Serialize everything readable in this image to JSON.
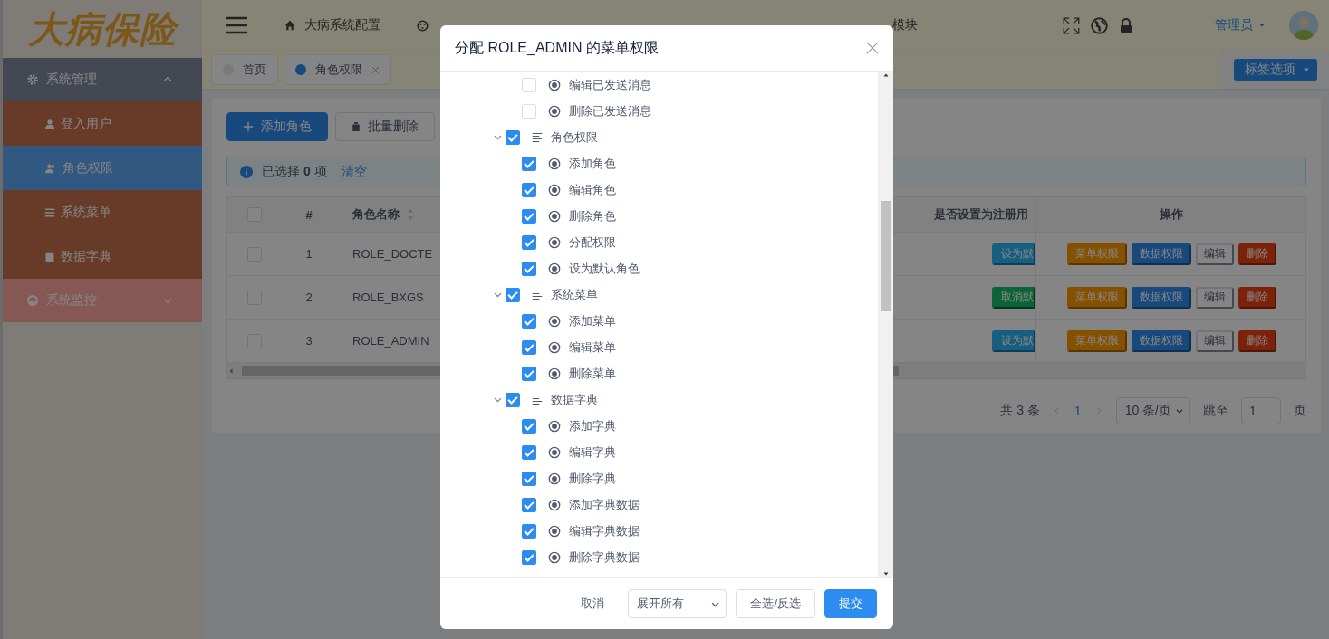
{
  "sidebar": {
    "logo": "大病保险",
    "menu": [
      {
        "label": "系统管理",
        "expanded": true,
        "children": [
          {
            "label": "登入用户",
            "selected": false
          },
          {
            "label": "角色权限",
            "selected": true
          },
          {
            "label": "系统菜单",
            "selected": false
          },
          {
            "label": "数据字典",
            "selected": false
          }
        ]
      },
      {
        "label": "系统监控",
        "expanded": false
      }
    ]
  },
  "header": {
    "nav": [
      {
        "kind": "link",
        "label": "大病系统配置"
      },
      {
        "kind": "icon"
      },
      {
        "kind": "text",
        "label": "模块"
      }
    ],
    "user": "管理员"
  },
  "tabs": [
    {
      "label": "首页",
      "selected": false,
      "closable": false
    },
    {
      "label": "角色权限",
      "selected": true,
      "closable": true
    }
  ],
  "tab_options": "标签选项",
  "toolbar": [
    {
      "label": "添加角色",
      "kind": "primary"
    },
    {
      "label": "批量删除",
      "kind": "default"
    }
  ],
  "alert": {
    "text": "已选择 **0** 项",
    "link": "清空"
  },
  "table": {
    "header_checked": false,
    "columns": [
      {
        "label": "#"
      },
      {
        "label": "角色名称",
        "sortable": true
      },
      {
        "label": "是否设置为注册用"
      },
      {
        "label": "操作"
      }
    ],
    "rows": [
      {
        "checked": false,
        "index": "1",
        "name": "ROLE_DOCTE",
        "default_button": {
          "label": "设为默",
          "kind": "info"
        },
        "actions": [
          {
            "label": "菜单权限",
            "kind": "warning"
          },
          {
            "label": "数据权限",
            "kind": "primary"
          },
          {
            "label": "编辑",
            "kind": "default"
          },
          {
            "label": "删除",
            "kind": "danger"
          }
        ]
      },
      {
        "checked": false,
        "index": "2",
        "name": "ROLE_BXGS",
        "default_button": {
          "label": "取消默",
          "kind": "success"
        },
        "actions": [
          {
            "label": "菜单权限",
            "kind": "warning"
          },
          {
            "label": "数据权限",
            "kind": "primary"
          },
          {
            "label": "编辑",
            "kind": "default"
          },
          {
            "label": "删除",
            "kind": "danger"
          }
        ]
      },
      {
        "checked": false,
        "index": "3",
        "name": "ROLE_ADMIN",
        "default_button": {
          "label": "设为默",
          "kind": "info"
        },
        "actions": [
          {
            "label": "菜单权限",
            "kind": "warning"
          },
          {
            "label": "数据权限",
            "kind": "primary"
          },
          {
            "label": "编辑",
            "kind": "default"
          },
          {
            "label": "删除",
            "kind": "danger"
          }
        ]
      }
    ]
  },
  "pagination": {
    "total": "共 3 条",
    "pages": [
      {
        "label": "1",
        "selected": true
      }
    ],
    "page_size": "10 条/页",
    "jump_label": "跳至",
    "jump_value": "1",
    "page_suffix": "页"
  },
  "modal": {
    "title": "分配 ROLE_ADMIN 的菜单权限",
    "tree": [
      {
        "children": [
          {
            "label": "编辑已发送消息",
            "checked": false
          },
          {
            "label": "删除已发送消息",
            "checked": false
          }
        ]
      },
      {
        "label": "角色权限",
        "checked": true,
        "expanded": true,
        "children": [
          {
            "label": "添加角色",
            "checked": true
          },
          {
            "label": "编辑角色",
            "checked": true
          },
          {
            "label": "删除角色",
            "checked": true
          },
          {
            "label": "分配权限",
            "checked": true
          },
          {
            "label": "设为默认角色",
            "checked": true
          }
        ]
      },
      {
        "label": "系统菜单",
        "checked": true,
        "expanded": true,
        "children": [
          {
            "label": "添加菜单",
            "checked": true
          },
          {
            "label": "编辑菜单",
            "checked": true
          },
          {
            "label": "删除菜单",
            "checked": true
          }
        ]
      },
      {
        "label": "数据字典",
        "checked": true,
        "expanded": true,
        "children": [
          {
            "label": "添加字典",
            "checked": true
          },
          {
            "label": "编辑字典",
            "checked": true
          },
          {
            "label": "删除字典",
            "checked": true
          },
          {
            "label": "添加字典数据",
            "checked": true
          },
          {
            "label": "编辑字典数据",
            "checked": true
          },
          {
            "label": "删除字典数据",
            "checked": true
          }
        ]
      }
    ],
    "footer": {
      "cancel": "取消",
      "expand_select": "展开所有",
      "toggle_all": "全选/反选",
      "submit": "提交"
    }
  }
}
